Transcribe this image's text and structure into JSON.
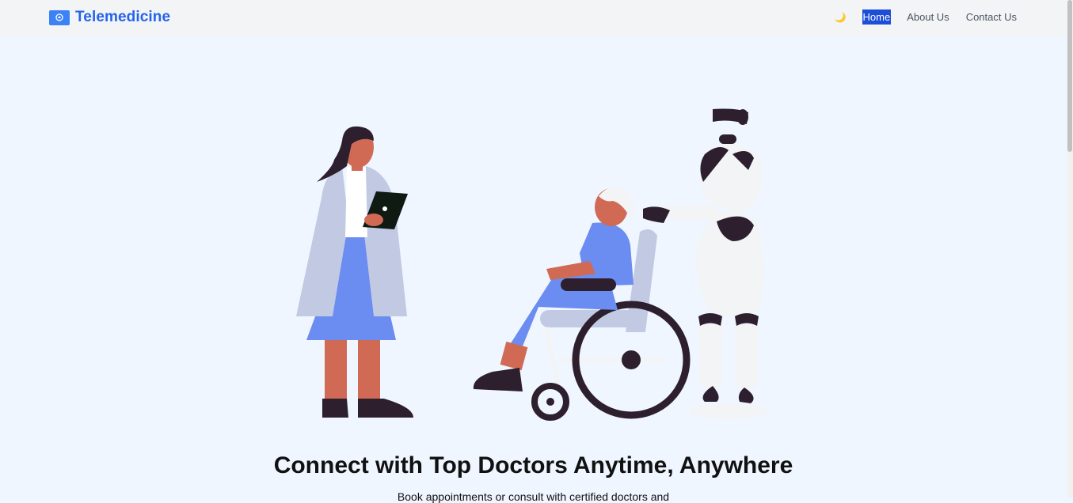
{
  "navbar": {
    "brand": "Telemedicine",
    "theme_toggle_icon": "moon-icon",
    "theme_toggle_glyph": "🌙",
    "links": [
      {
        "label": "Home",
        "active": true
      },
      {
        "label": "About Us",
        "active": false
      },
      {
        "label": "Contact Us",
        "active": false
      }
    ]
  },
  "hero": {
    "heading": "Connect with Top Doctors Anytime, Anywhere",
    "subheading": "Book appointments or consult with certified doctors and"
  },
  "colors": {
    "brand": "#2563eb",
    "active_link_bg": "#1d4ed8",
    "page_bg": "#eff6ff",
    "navbar_bg": "#f3f4f6"
  }
}
